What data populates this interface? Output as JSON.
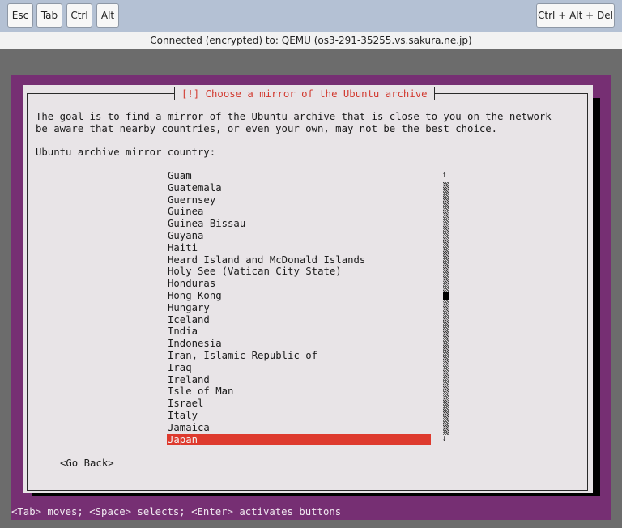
{
  "toolbar": {
    "esc": "Esc",
    "tab": "Tab",
    "ctrl": "Ctrl",
    "alt": "Alt",
    "ctrl_alt_del": "Ctrl + Alt + Del"
  },
  "status_text": "Connected (encrypted) to: QEMU (os3-291-35255.vs.sakura.ne.jp)",
  "dialog": {
    "title": "[!] Choose a mirror of the Ubuntu archive",
    "description_line1": "The goal is to find a mirror of the Ubuntu archive that is close to you on the network --",
    "description_line2": "be aware that nearby countries, or even your own, may not be the best choice.",
    "prompt": "Ubuntu archive mirror country:",
    "countries": [
      "Guam",
      "Guatemala",
      "Guernsey",
      "Guinea",
      "Guinea-Bissau",
      "Guyana",
      "Haiti",
      "Heard Island and McDonald Islands",
      "Holy See (Vatican City State)",
      "Honduras",
      "Hong Kong",
      "Hungary",
      "Iceland",
      "India",
      "Indonesia",
      "Iran, Islamic Republic of",
      "Iraq",
      "Ireland",
      "Isle of Man",
      "Israel",
      "Italy",
      "Jamaica",
      "Japan"
    ],
    "selected": "Japan",
    "scroll_up": "↑",
    "scroll_down": "↓",
    "go_back": "<Go Back>"
  },
  "hint": "<Tab> moves; <Space> selects; <Enter> activates buttons",
  "colors": {
    "console_bg": "#762f73",
    "dialog_bg": "#e8e4e7",
    "title_red": "#d23a30",
    "selection": "#de3a2e"
  }
}
